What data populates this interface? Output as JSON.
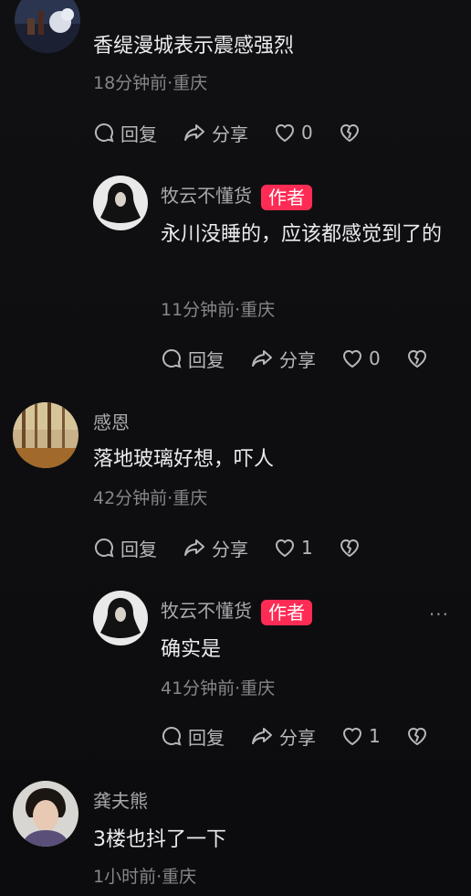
{
  "comments": [
    {
      "name": "",
      "text": "香缇漫城表示震感强烈",
      "meta": "18分钟前·重庆",
      "reply": "回复",
      "share": "分享",
      "likes": "0"
    },
    {
      "name": "牧云不懂货",
      "badge": "作者",
      "text": "永川没睡的，应该都感觉到了的",
      "meta": "11分钟前·重庆",
      "reply": "回复",
      "share": "分享",
      "likes": "0"
    },
    {
      "name": "感恩",
      "text": "落地玻璃好想，吓人",
      "meta": "42分钟前·重庆",
      "reply": "回复",
      "share": "分享",
      "likes": "1"
    },
    {
      "name": "牧云不懂货",
      "badge": "作者",
      "text": "确实是",
      "meta": "41分钟前·重庆",
      "reply": "回复",
      "share": "分享",
      "likes": "1",
      "more": "···"
    },
    {
      "name": "龚夫熊",
      "text": "3楼也抖了一下",
      "meta": "1小时前·重庆"
    }
  ],
  "icons": {
    "reply": "speech-bubble-icon",
    "share": "share-arrow-icon",
    "like": "heart-icon",
    "dislike": "broken-heart-icon",
    "more": "more-dots-icon"
  },
  "colors": {
    "background": "#0e0e0f",
    "author_badge": "#fe2c55",
    "meta": "#86868b",
    "text": "#ececee"
  }
}
